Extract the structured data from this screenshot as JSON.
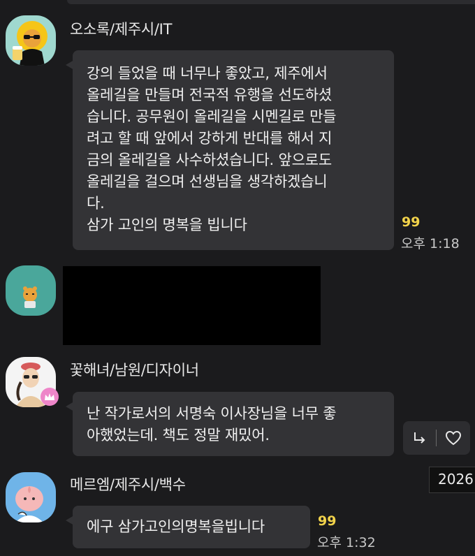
{
  "messages": [
    {
      "sender": "오소록/제주시/IT",
      "avatar_icon": "ryan-lion-beer-avatar",
      "lines": [
        "강의 들었을 때 너무나 좋았고, 제주에서",
        "올레길을 만들며 전국적 유행을 선도하셨",
        "습니다. 공무원이 올레길을 시멘길로 만들",
        "려고 할 때 앞에서 강하게 반대를 해서 지",
        "금의 올레길을 사수하셨습니다. 앞으로도",
        "올레길을 걸으며 선생님을 생각하겠습니",
        "다.",
        "삼가 고인의 명복을 빕니다"
      ],
      "read_count": "99",
      "time": "오후 1:18"
    },
    {
      "sender": "",
      "avatar_icon": "ryan-avatar-teal",
      "hidden_content": "redacted"
    },
    {
      "sender": "꽃해녀/남원/디자이너",
      "avatar_icon": "haenyeo-avatar",
      "badge_icon": "crown-icon",
      "lines": [
        "난 작가로서의 서명숙 이사장님을 너무 좋",
        "아했었는데. 책도 정말 재밌어."
      ],
      "actions": {
        "reply_icon": "reply-arrow-icon",
        "like_icon": "heart-icon"
      }
    },
    {
      "sender": "메르엠/제주시/백수",
      "avatar_icon": "apeach-avatar",
      "lines": [
        "에구 삼가고인의명복을빕니다"
      ],
      "read_count": "99",
      "time": "오후 1:32"
    }
  ],
  "date_tooltip": "2026",
  "colors": {
    "background": "#1b1b1d",
    "bubble": "#333336",
    "read_count": "#f2d34b",
    "crown_badge": "#ee86c9"
  }
}
